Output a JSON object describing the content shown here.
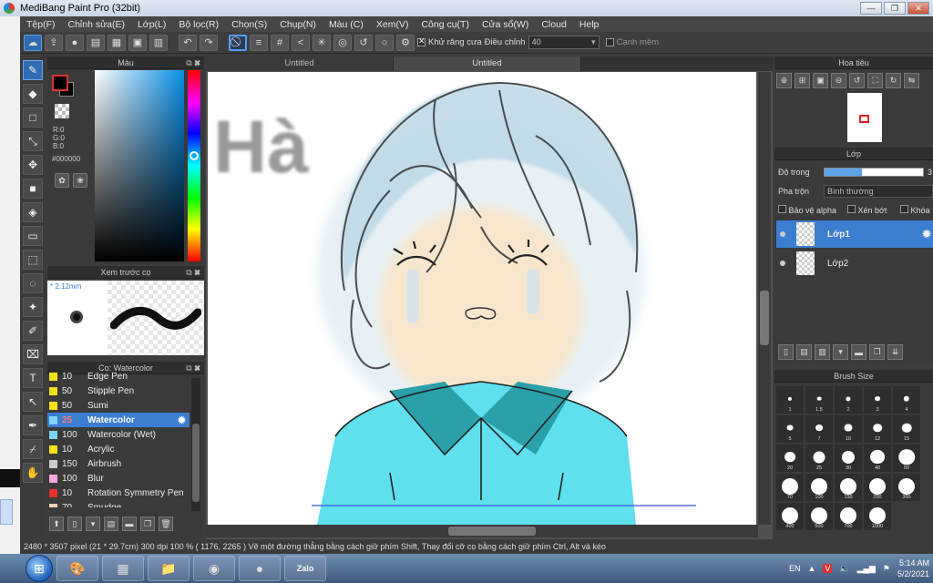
{
  "window": {
    "title": "MediBang Paint Pro (32bit)"
  },
  "menu": [
    "Tệp(F)",
    "Chỉnh sửa(E)",
    "Lớp(L)",
    "Bộ lọc(R)",
    "Chọn(S)",
    "Chụp(N)",
    "Màu (C)",
    "Xem(V)",
    "Công cụ(T)",
    "Cửa sổ(W)",
    "Cloud",
    "Help"
  ],
  "toolbar": {
    "antialias_label": "Khử răng cưa",
    "correction_label": "Điều chỉnh",
    "correction_value": "40",
    "soft_edge_label": "Cạnh mềm"
  },
  "color_panel": {
    "title": "Màu",
    "r": "R:0",
    "g": "G:0",
    "b": "B:0",
    "hex": "#000000",
    "fg_color": "#000000"
  },
  "preview_panel": {
    "title": "Xem trước cọ",
    "size": "* 2.12mm"
  },
  "brush_panel": {
    "title": "Cọ: Watercolor",
    "items": [
      {
        "size": "10",
        "name": "Edge Pen",
        "color": "#f2e21a"
      },
      {
        "size": "50",
        "name": "Stipple Pen",
        "color": "#f2e21a"
      },
      {
        "size": "50",
        "name": "Sumi",
        "color": "#f2e21a"
      },
      {
        "size": "25",
        "name": "Watercolor",
        "color": "#7fd3f7",
        "selected": true
      },
      {
        "size": "100",
        "name": "Watercolor (Wet)",
        "color": "#7fd3f7"
      },
      {
        "size": "10",
        "name": "Acrylic",
        "color": "#f2e21a"
      },
      {
        "size": "150",
        "name": "Airbrush",
        "color": "#cccccc"
      },
      {
        "size": "100",
        "name": "Blur",
        "color": "#f7a8e0"
      },
      {
        "size": "10",
        "name": "Rotation Symmetry Pen",
        "color": "#e83030"
      },
      {
        "size": "70",
        "name": "Smudge",
        "color": "#f5d0b0"
      }
    ]
  },
  "canvas": {
    "tabs": [
      "Untitled",
      "Untitled"
    ],
    "lettering": "Hà"
  },
  "navigator": {
    "title": "Hoa tiêu"
  },
  "layers": {
    "title": "Lớp",
    "opacity_label": "Độ trong",
    "opacity_value": "3",
    "opacity_fraction": 0.38,
    "blend_label": "Pha trộn",
    "blend_value": "Bình thường",
    "protect_alpha": "Bảo vệ alpha",
    "clipping": "Xén bớt",
    "lock": "Khóa",
    "items": [
      {
        "name": "Lớp1",
        "selected": true
      },
      {
        "name": "Lớp2",
        "selected": false
      }
    ]
  },
  "brush_size": {
    "title": "Brush Size",
    "sizes": [
      "1",
      "1.5",
      "2",
      "3",
      "4",
      "5",
      "7",
      "10",
      "12",
      "15",
      "20",
      "25",
      "30",
      "40",
      "50",
      "70",
      "100",
      "150",
      "200",
      "300",
      "400",
      "500",
      "700",
      "1000"
    ]
  },
  "status": "2480 * 3507 pixel  (21 * 29.7cm)  300 dpi  100 %  ( 1176, 2265 )  Vẽ một đường thẳng bằng cách giữ phím Shift, Thay đổi cỡ cọ bằng cách giữ phím Ctrl, Alt và kéo",
  "taskbar": {
    "lang": "EN",
    "time": "5:14 AM",
    "date": "5/2/2021",
    "zalo": "Zalo"
  }
}
